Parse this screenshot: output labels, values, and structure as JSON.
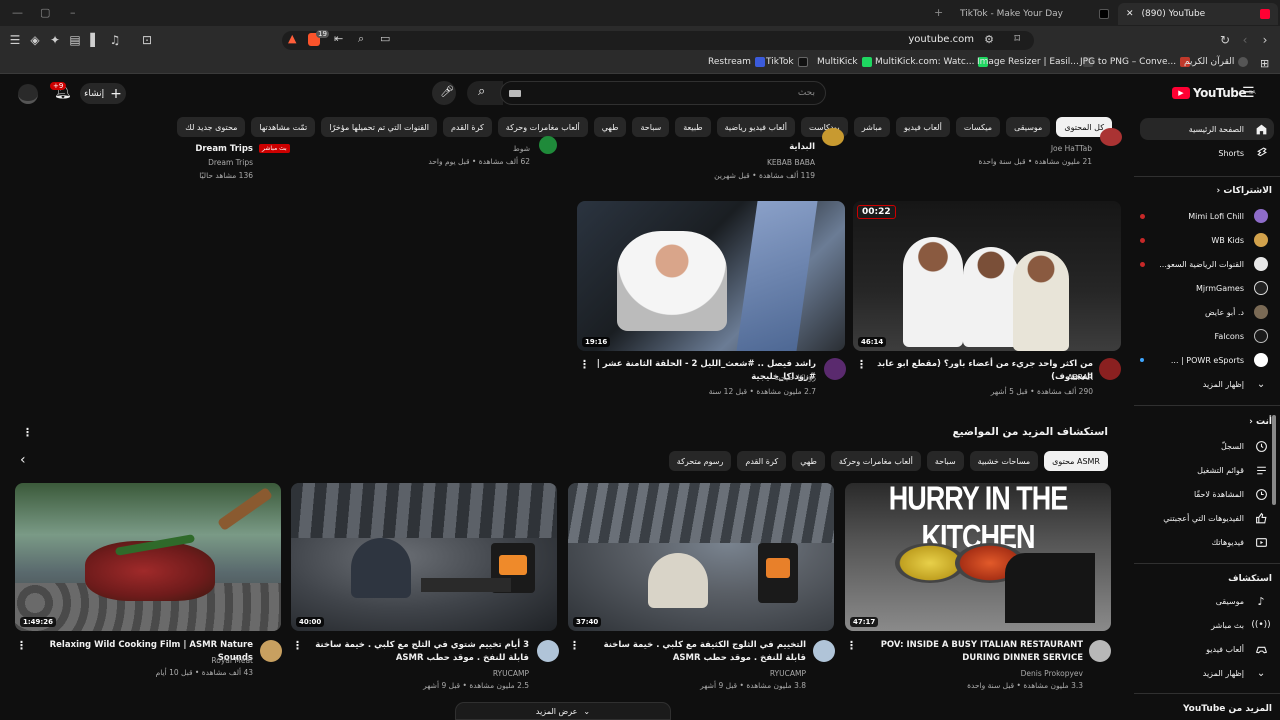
{
  "browser": {
    "tabs": [
      {
        "title": "TikTok - Make Your Day"
      },
      {
        "title": "(890) YouTube"
      }
    ],
    "url": "youtube.com",
    "shield_count": "19",
    "bookmarks": [
      {
        "label": "Restream",
        "color": "#3b5bdb"
      },
      {
        "label": "TikTok",
        "color": "#111111"
      },
      {
        "label": "MultiKick",
        "color": "#1ed760"
      },
      {
        "label": "MultiKick.com: Watc...",
        "color": "#1ed760"
      },
      {
        "label": "Image Resizer | Easil...",
        "color": "#444444"
      },
      {
        "label": "JPG to PNG – Conve...",
        "color": "#c0392b"
      },
      {
        "label": "القرآن الكريم",
        "color": "#555555"
      }
    ]
  },
  "header": {
    "search_placeholder": "بحث",
    "create_label": "إنشاء",
    "notif_count": "+9",
    "logo_text": "YouTube",
    "region": "SA"
  },
  "chips": [
    "كل المحتوى",
    "موسيقى",
    "ميكسات",
    "ألعاب فيديو",
    "مباشر",
    "بودكاست",
    "ألعاب فيديو رياضية",
    "طبيعة",
    "سباحة",
    "طهي",
    "ألعاب مغامرات وحركة",
    "كرة القدم",
    "القنوات التي تم تحميلها مؤخرًا",
    "تمّت مشاهدتها",
    "محتوى جديد لك"
  ],
  "sidebar": {
    "home": "الصفحة الرئيسية",
    "shorts": "Shorts",
    "subscriptions_heading": "الاشتراكات",
    "subscriptions": [
      {
        "label": "Mimi Lofi Chill",
        "color": "#8e6cc9"
      },
      {
        "label": "WB Kids",
        "color": "#d2a24c"
      },
      {
        "label": "القنوات الرياضية السعو...",
        "color": "#e8e8e8"
      },
      {
        "label": "MjrmGames",
        "color": "#222222"
      },
      {
        "label": "د. أبو عايض",
        "color": "#7a6a55"
      },
      {
        "label": "Falcons",
        "color": "#1a1a1a"
      },
      {
        "label": "POWR eSports | ...",
        "color": "#ffffff"
      }
    ],
    "show_more": "إظهار المزيد",
    "you_heading": "أنت",
    "you_items": [
      "السجلّ",
      "قوائم التشغيل",
      "المشاهدة لاحقًا",
      "الفيديوهات التي أعجبتني",
      "فيديوهاتك"
    ],
    "explore_heading": "استكشاف",
    "explore_items": [
      "موسيقى",
      "بث مباشر",
      "ألعاب فيديو"
    ],
    "explore_more": "إظهار المزيد",
    "more_from": "المزيد من YouTube"
  },
  "top_partial": [
    {
      "title": "Dream Trips",
      "badge": "بث مباشر",
      "channel": "Dream Trips",
      "meta": "136 مشاهد حاليًا"
    },
    {
      "channel": "شوط",
      "meta": "62 ألف مشاهدة • قبل يوم واحد"
    },
    {
      "title": "البداية",
      "channel": "KEBAB BABA",
      "meta": "119 ألف مشاهدة • قبل شهرين"
    },
    {
      "channel": "Joe HaTTab",
      "meta": "21 مليون مشاهدة • قبل سنة واحدة"
    }
  ],
  "row_videos": [
    {
      "duration": "19:16",
      "title": "راشد فيصل .. #شعث_الليل 2 - الحلقة الثامنة عشر | #زوداكا_خليجية",
      "channel": "زوداكا خليجية",
      "meta": "2.7 مليون مشاهدة • قبل 12 سنة"
    },
    {
      "duration": "46:14",
      "badge_time": "00:22",
      "title": "من اكثر واحد جريء من أعضاء باور؟ (مقطع ابو عابد المحذوف)",
      "channel": "ABRAR",
      "meta": "290 ألف مشاهدة • قبل 5 أشهر"
    }
  ],
  "explore": {
    "title": "استكشاف المزيد من المواضيع",
    "chips": [
      "محتوى ASMR",
      "مساحات خشبية",
      "سباحة",
      "ألعاب مغامرات وحركة",
      "طهي",
      "كرة القدم",
      "رسوم متحركة"
    ],
    "videos": [
      {
        "duration": "47:17",
        "title": "POV: INSIDE A BUSY ITALIAN RESTAURANT DURING DINNER SERVICE",
        "channel": "Denis Prokopyev",
        "meta": "3.3 مليون مشاهدة • قبل سنة واحدة",
        "thumb_text": "HURRY IN THE KITCHEN"
      },
      {
        "duration": "37:40",
        "title": "التخييم في الثلوج الكثيفة مع كلبي . خيمة ساخنة قابلة للنفخ . موقد حطب ASMR",
        "channel": "RYUCAMP",
        "meta": "3.8 مليون مشاهدة • قبل 9 أشهر"
      },
      {
        "duration": "40:00",
        "title": "3 أيام تخييم شتوي في الثلج مع كلبي . خيمة ساخنة قابلة للنفخ . موقد حطب ASMR",
        "channel": "RYUCAMP",
        "meta": "2.5 مليون مشاهدة • قبل 9 أشهر"
      },
      {
        "duration": "1:49:26",
        "title": "Relaxing Wild Cooking Film | ASMR Nature Sounds",
        "channel": "Royal Meat",
        "meta": "43 ألف مشاهدة • قبل 10 أيام"
      }
    ],
    "show_more": "عرض المزيد"
  }
}
